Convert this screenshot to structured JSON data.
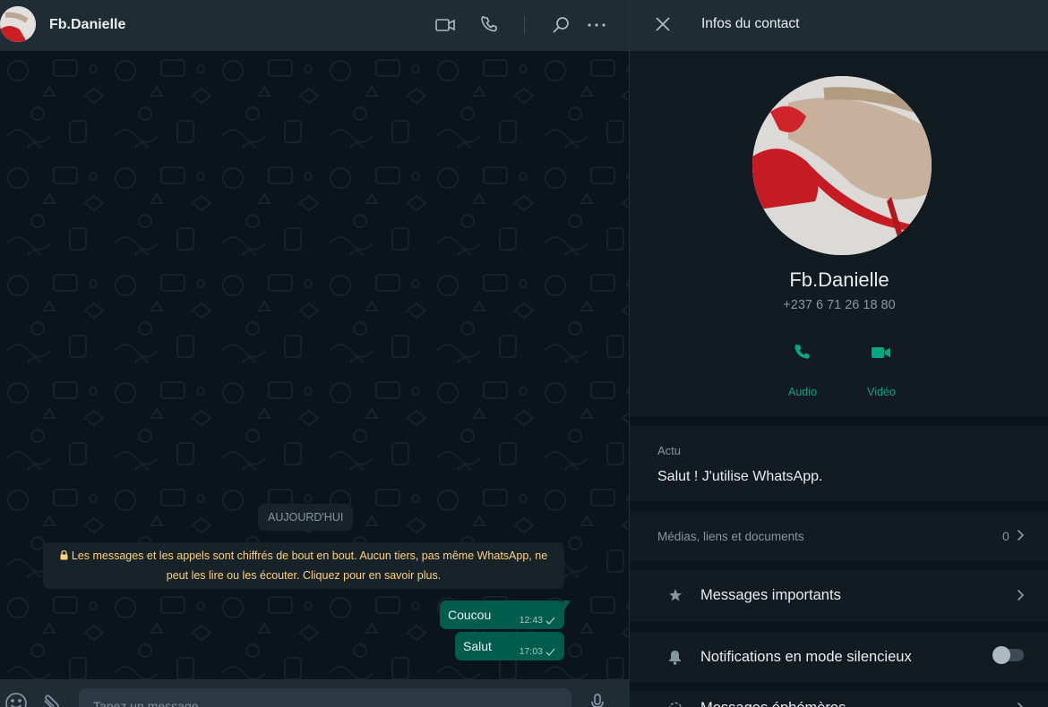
{
  "colors": {
    "accent": "#00a884",
    "outgoing_bubble": "#005c4b",
    "panel": "#202c33",
    "background": "#0b141a",
    "notice_text": "#ffd279"
  },
  "chat": {
    "contact_name": "Fb.Danielle",
    "header_icons": [
      "video-call-icon",
      "voice-call-icon",
      "search-icon",
      "menu-icon"
    ],
    "day_label": "AUJOURD'HUI",
    "encryption_notice": "Les messages et les appels sont chiffrés de bout en bout. Aucun tiers, pas même WhatsApp, ne peut les lire ou les écouter. Cliquez pour en savoir plus.",
    "messages": [
      {
        "text": "Coucou",
        "time": "12:43",
        "status": "sent"
      },
      {
        "text": "Salut",
        "time": "17:03",
        "status": "sent"
      }
    ],
    "composer": {
      "placeholder": "Tapez un message"
    }
  },
  "contact_info": {
    "title": "Infos du contact",
    "name": "Fb.Danielle",
    "phone": "+237 6 71 26 18 80",
    "actions": {
      "audio": "Audio",
      "video": "Vidéo"
    },
    "about": {
      "label": "Actu",
      "value": "Salut ! J'utilise WhatsApp."
    },
    "media": {
      "label": "Médias, liens et documents",
      "count": "0"
    },
    "starred": {
      "label": "Messages importants"
    },
    "mute": {
      "label": "Notifications en mode silencieux",
      "enabled": false
    },
    "ephemeral": {
      "label": "Messages éphémères"
    }
  }
}
